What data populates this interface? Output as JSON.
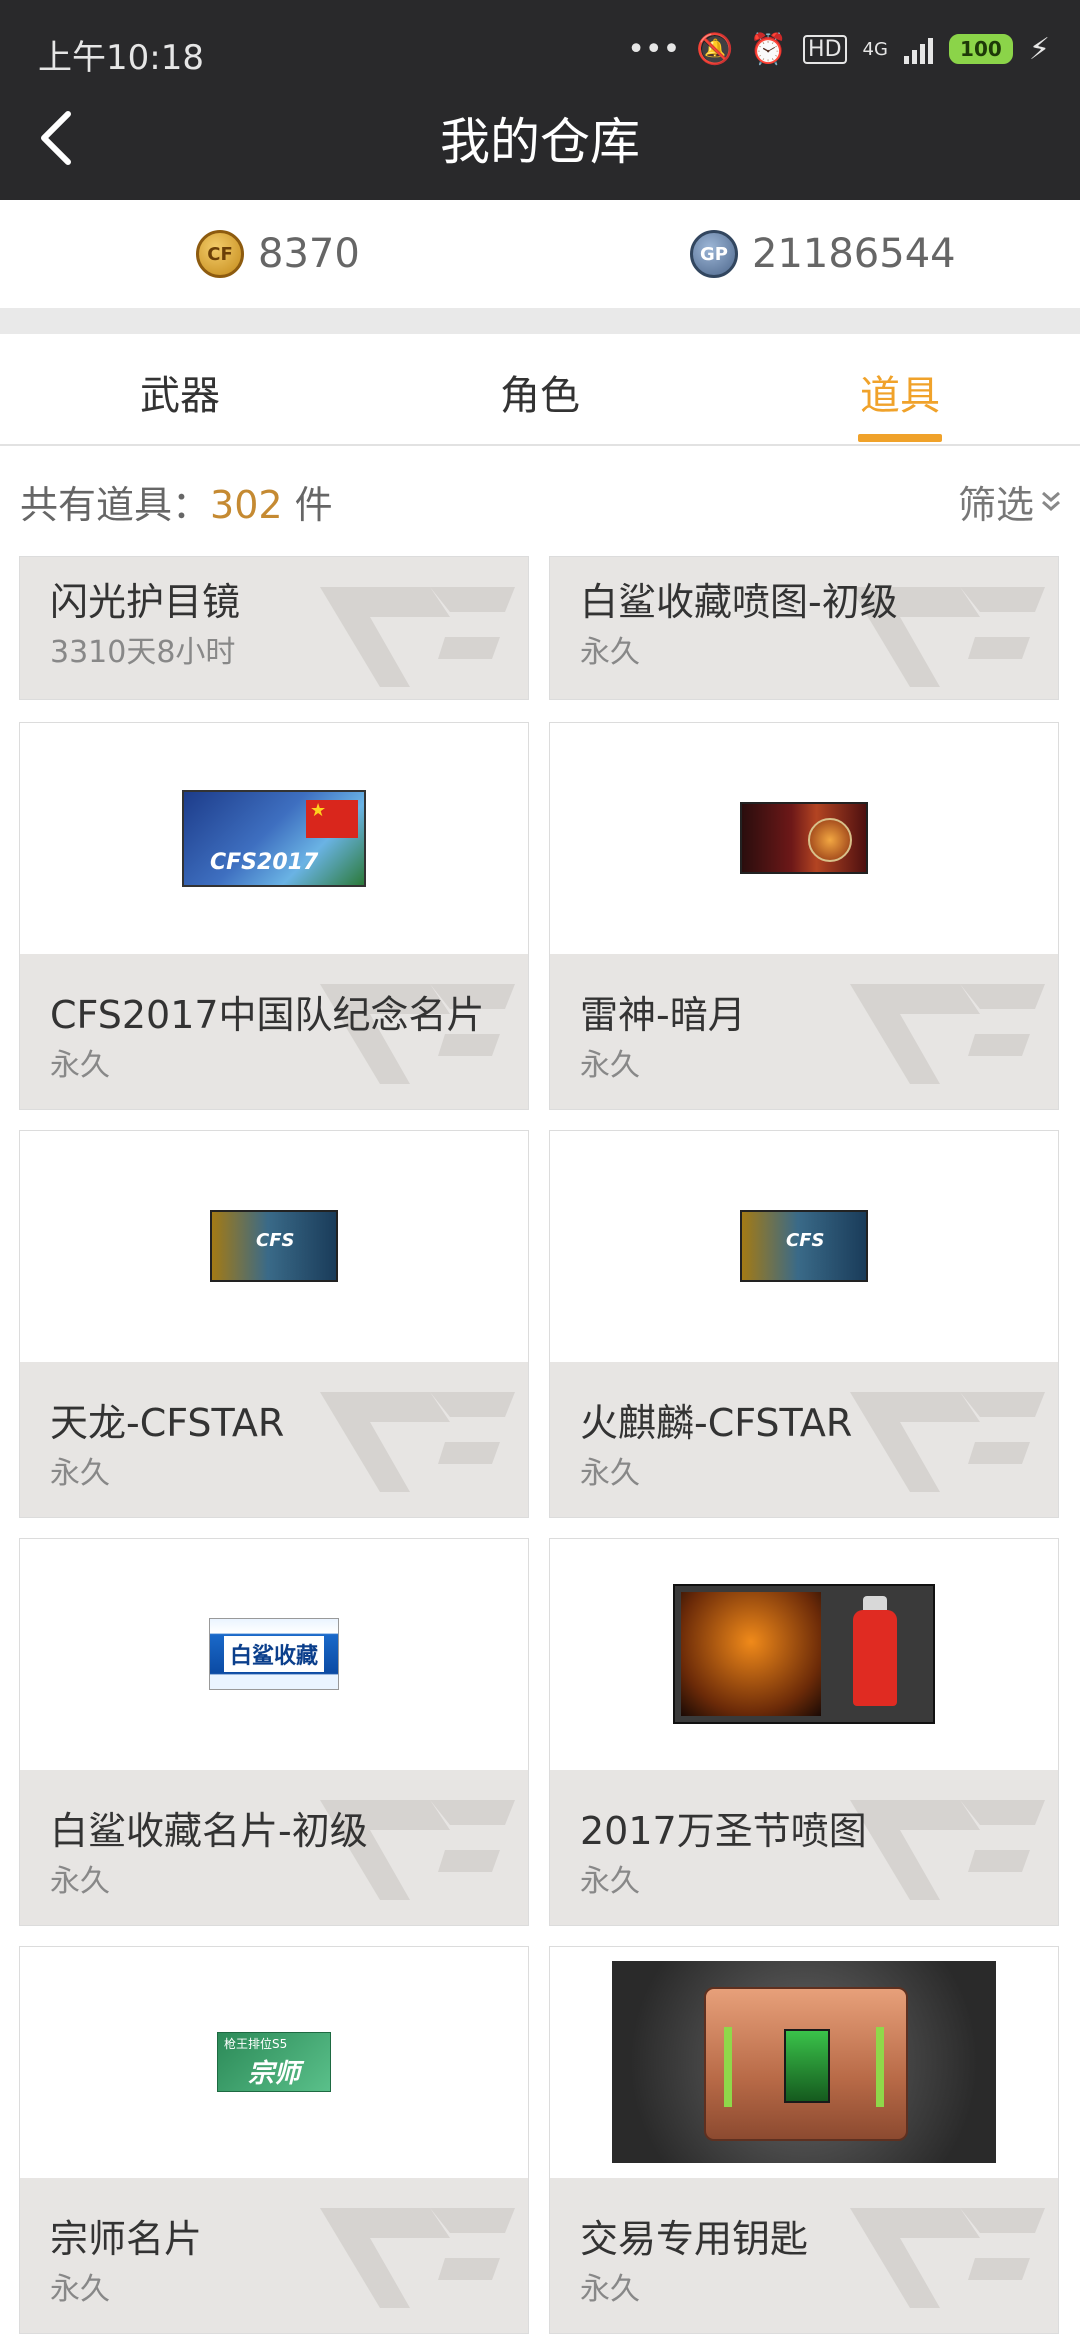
{
  "status_bar": {
    "time": "上午10:18",
    "network": "4G",
    "battery": "100"
  },
  "header": {
    "title": "我的仓库",
    "back_icon": "chevron-left-icon"
  },
  "currency": {
    "cf_points": "8370",
    "gp_points": "21186544",
    "cf_icon_label": "CF",
    "gp_icon_label": "GP"
  },
  "tabs": [
    {
      "label": "武器",
      "active": false
    },
    {
      "label": "角色",
      "active": false
    },
    {
      "label": "道具",
      "active": true
    }
  ],
  "summary": {
    "prefix": "共有道具：",
    "count": "302",
    "unit": " 件",
    "filter_label": "筛选"
  },
  "items": [
    {
      "name": "闪光护目镜",
      "duration": "3310天8小时"
    },
    {
      "name": "白鲨收藏喷图-初级",
      "duration": "永久"
    },
    {
      "name": "CFS2017中国队纪念名片",
      "duration": "永久",
      "thumb_text": "CFS2017"
    },
    {
      "name": "雷神-暗月",
      "duration": "永久"
    },
    {
      "name": "天龙-CFSTAR",
      "duration": "永久",
      "thumb_text": "CFS"
    },
    {
      "name": "火麒麟-CFSTAR",
      "duration": "永久",
      "thumb_text": "CFS"
    },
    {
      "name": "白鲨收藏名片-初级",
      "duration": "永久",
      "thumb_text": "白鲨收藏"
    },
    {
      "name": "2017万圣节喷图",
      "duration": "永久"
    },
    {
      "name": "宗师名片",
      "duration": "永久",
      "thumb_text": "枪王排位S5",
      "thumb_text2": "宗师"
    },
    {
      "name": "交易专用钥匙",
      "duration": "永久"
    }
  ],
  "colors": {
    "accent": "#f0a22a",
    "count": "#c58a32",
    "header_bg": "#29292b"
  }
}
